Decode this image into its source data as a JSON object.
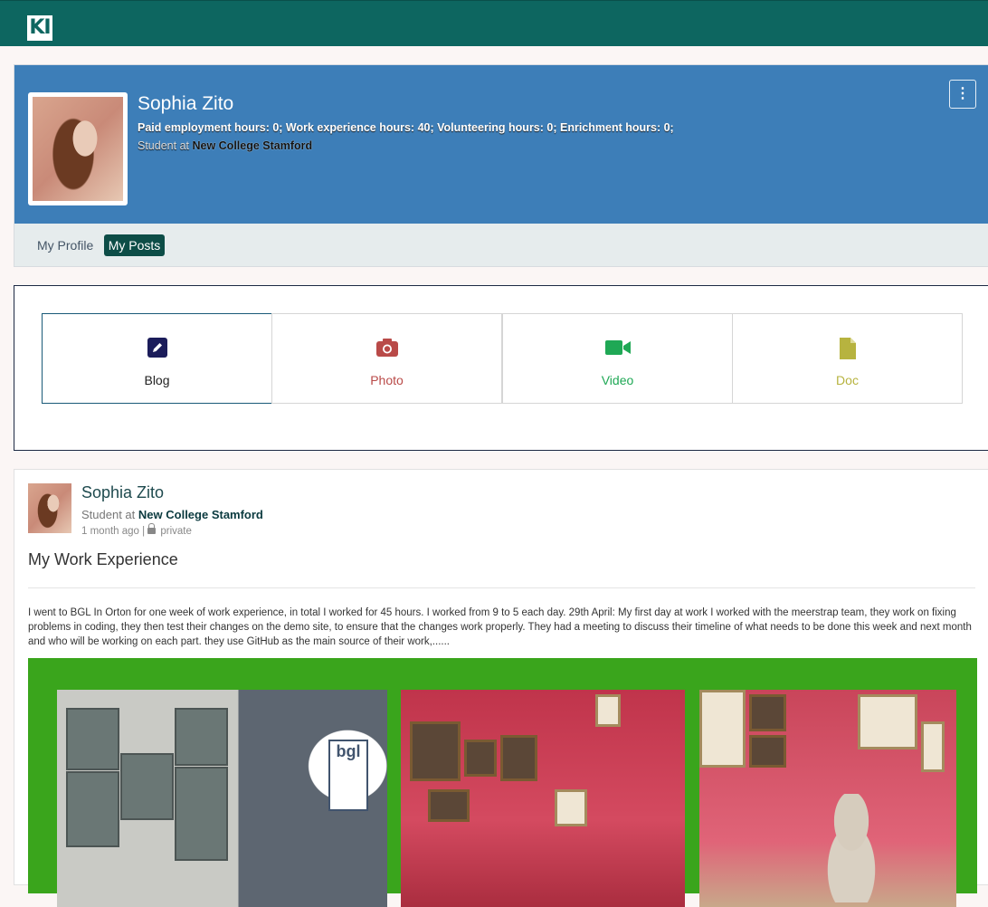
{
  "app": {
    "logo_text": "KI"
  },
  "profile": {
    "name": "Sophia Zito",
    "hours": "Paid employment hours: 0; Work experience hours: 40; Volunteering hours: 0; Enrichment hours: 0;",
    "student_prefix": "Student at",
    "college": "New College Stamford",
    "menu_icon": "kebab-icon",
    "tabs": [
      {
        "label": "My Profile",
        "active": false
      },
      {
        "label": "My Posts",
        "active": true
      }
    ]
  },
  "composer": {
    "types": [
      {
        "label": "Blog",
        "icon": "pencil-square-icon",
        "color": "#1b1c5a"
      },
      {
        "label": "Photo",
        "icon": "camera-icon",
        "color": "#b94a48"
      },
      {
        "label": "Video",
        "icon": "video-camera-icon",
        "color": "#1fa855"
      },
      {
        "label": "Doc",
        "icon": "document-icon",
        "color": "#b7b33f"
      }
    ]
  },
  "post": {
    "author": "Sophia Zito",
    "student_prefix": "Student at",
    "college": "New College Stamford",
    "time": "1 month ago",
    "separator": "|",
    "visibility": "private",
    "title": "My Work Experience",
    "body": "I went to BGL In Orton for one week of work experience, in total I worked for 45 hours. I worked from 9 to 5 each day. 29th April: My first day at work I worked with the meerstrap team, they work on fixing problems in coding, they then test their changes on the demo site, to ensure that the changes work properly. They had a meeting to discuss their timeline of what needs to be done this week and next month and who will be working on each part. they use GitHub as the main source of their work,......",
    "gallery_bg": "#3aa51c",
    "images": [
      {
        "alt": "bgl building"
      },
      {
        "alt": "red display wall"
      },
      {
        "alt": "meerkat statue"
      }
    ],
    "bgl_sign": "bgl"
  }
}
